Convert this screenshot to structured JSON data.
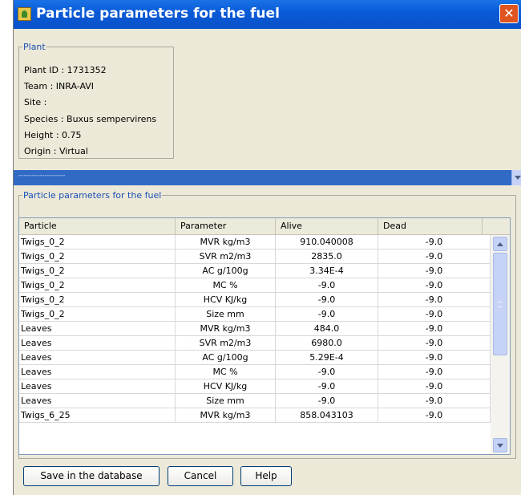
{
  "window": {
    "title": "Particle parameters for the fuel",
    "close_symbol": "✕"
  },
  "plant": {
    "legend": "Plant",
    "lines": [
      "Plant ID : 1731352",
      "Team : INRA-AVI",
      "Site :",
      "Species : Buxus sempervirens",
      "Height : 0.75",
      "Origin : Virtual"
    ]
  },
  "combo": {
    "value": "------------------"
  },
  "params": {
    "legend": "Particle parameters for the fuel",
    "columns": [
      "Particle",
      "Parameter",
      "Alive",
      "Dead"
    ],
    "rows": [
      [
        "Twigs_0_2",
        "MVR kg/m3",
        "910.040008",
        "-9.0"
      ],
      [
        "Twigs_0_2",
        "SVR m2/m3",
        "2835.0",
        "-9.0"
      ],
      [
        "Twigs_0_2",
        "AC g/100g",
        "3.34E-4",
        "-9.0"
      ],
      [
        "Twigs_0_2",
        "MC %",
        "-9.0",
        "-9.0"
      ],
      [
        "Twigs_0_2",
        "HCV KJ/kg",
        "-9.0",
        "-9.0"
      ],
      [
        "Twigs_0_2",
        "Size mm",
        "-9.0",
        "-9.0"
      ],
      [
        "Leaves",
        "MVR kg/m3",
        "484.0",
        "-9.0"
      ],
      [
        "Leaves",
        "SVR m2/m3",
        "6980.0",
        "-9.0"
      ],
      [
        "Leaves",
        "AC g/100g",
        "5.29E-4",
        "-9.0"
      ],
      [
        "Leaves",
        "MC %",
        "-9.0",
        "-9.0"
      ],
      [
        "Leaves",
        "HCV KJ/kg",
        "-9.0",
        "-9.0"
      ],
      [
        "Leaves",
        "Size mm",
        "-9.0",
        "-9.0"
      ],
      [
        "Twigs_6_25",
        "MVR kg/m3",
        "858.043103",
        "-9.0"
      ]
    ]
  },
  "buttons": {
    "save": "Save in the database",
    "cancel": "Cancel",
    "help": "Help"
  },
  "icons": {
    "app": "plant-app-icon",
    "close": "close-icon",
    "combo_arrow": "chevron-down-icon",
    "scroll_up": "scroll-up-arrow-icon",
    "scroll_down": "scroll-down-arrow-icon"
  }
}
